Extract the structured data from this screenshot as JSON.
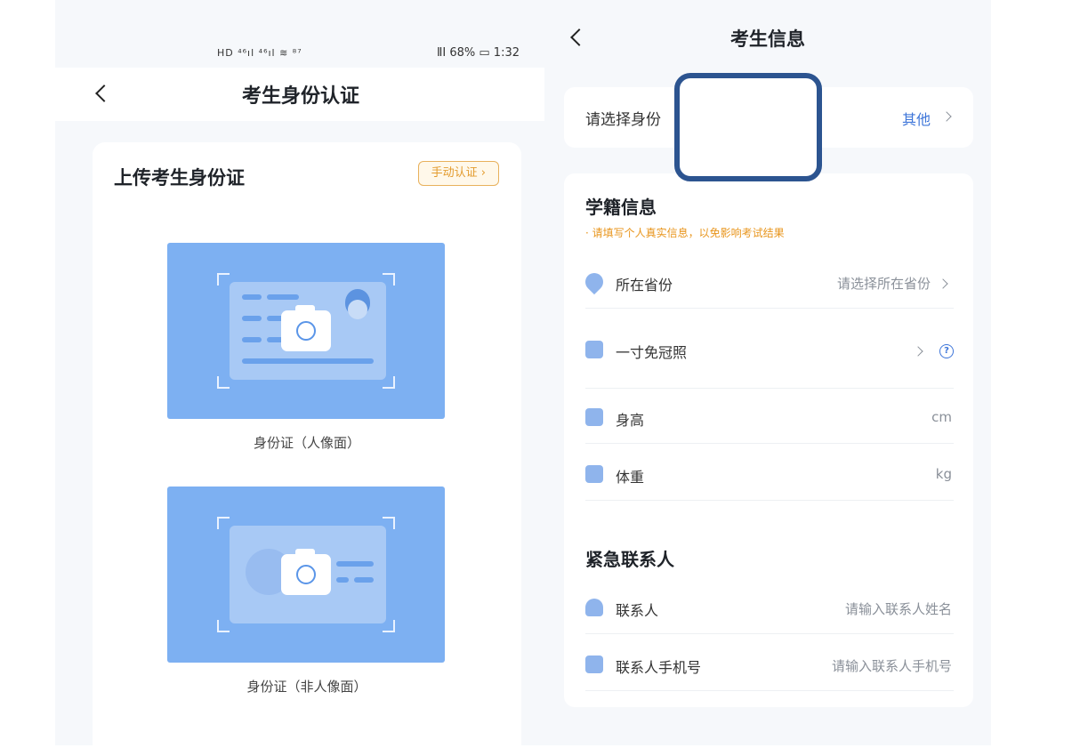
{
  "left": {
    "status": {
      "left_icons": "HD ⁴⁶ıl ⁴⁶ıl ≋ ⁸⁷",
      "right": "ⅡⅠ 68% ▭ 1:32"
    },
    "nav_title": "考生身份认证",
    "upload_title": "上传考生身份证",
    "manual_button": "手动认证 ›",
    "front_caption": "身份证（人像面）",
    "back_caption": "身份证（非人像面）"
  },
  "right": {
    "nav_title": "考生信息",
    "identity": {
      "label": "请选择身份",
      "value": "其他"
    },
    "school": {
      "title": "学籍信息",
      "notice": "· 请填写个人真实信息，以免影响考试结果",
      "rows": [
        {
          "label": "所在省份",
          "value": "请选择所在省份",
          "icon": "location-pin-icon"
        },
        {
          "label": "一寸免冠照",
          "value": "",
          "icon": "photo-icon"
        },
        {
          "label": "身高",
          "value": "cm",
          "icon": "height-icon"
        },
        {
          "label": "体重",
          "value": "kg",
          "icon": "scale-icon"
        }
      ]
    },
    "contact": {
      "title": "紧急联系人",
      "rows": [
        {
          "label": "联系人",
          "value": "请输入联系人姓名",
          "icon": "person-icon"
        },
        {
          "label": "联系人手机号",
          "value": "请输入联系人手机号",
          "icon": "phone-icon"
        }
      ]
    },
    "help_glyph": "?"
  }
}
